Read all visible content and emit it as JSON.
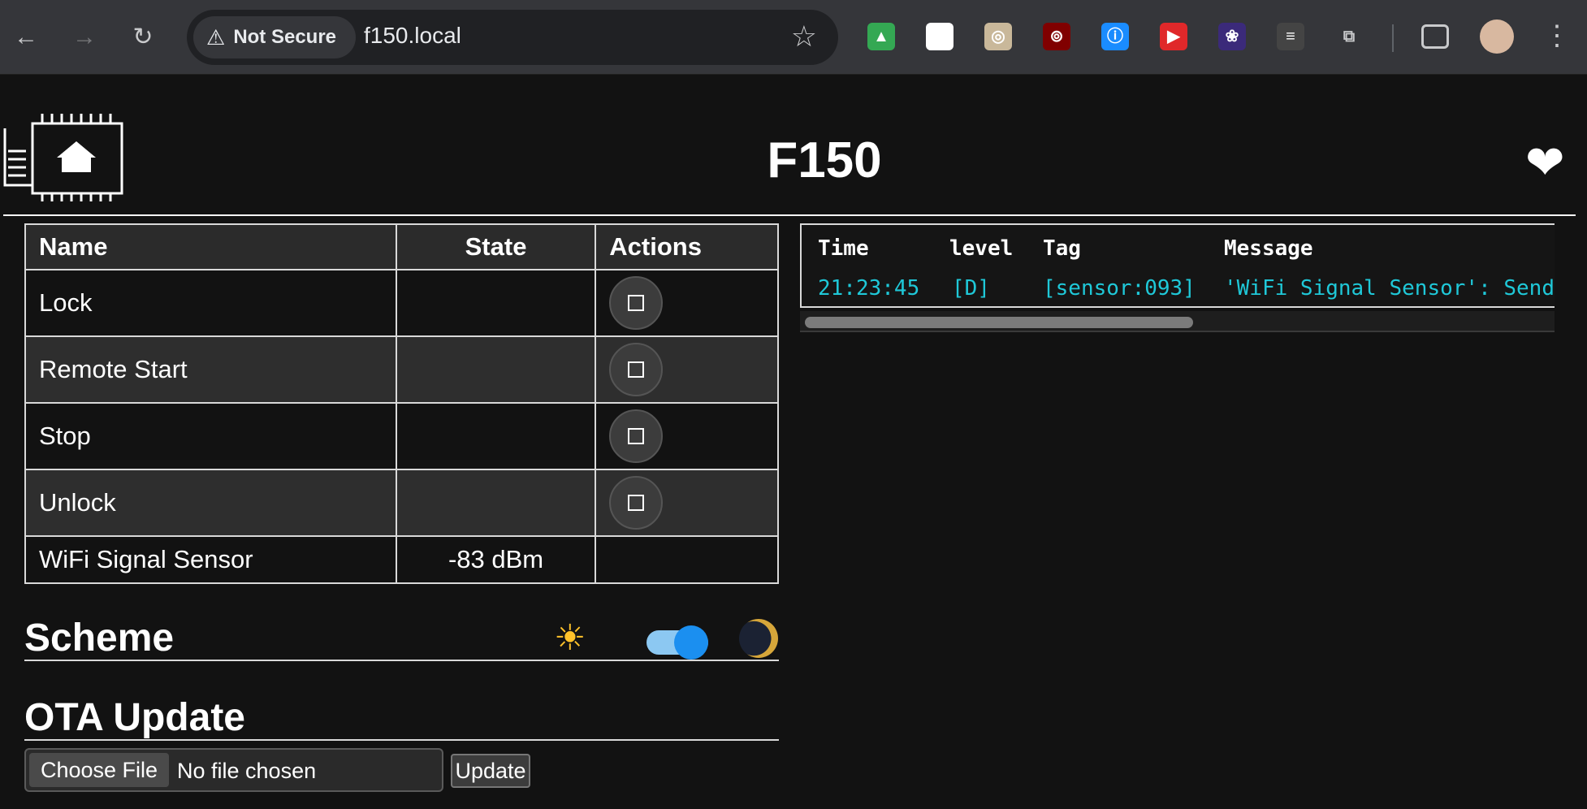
{
  "browser": {
    "security_label": "Not Secure",
    "url": "f150.local",
    "extensions": [
      {
        "icon": "google-drive-icon",
        "color": "#34a853"
      },
      {
        "icon": "picture-in-picture-icon",
        "color": "#ffffff"
      },
      {
        "icon": "owl-icon",
        "color": "#c9b89a"
      },
      {
        "icon": "ublock-origin-icon",
        "color": "#800000"
      },
      {
        "icon": "1password-icon",
        "color": "#1a8cff"
      },
      {
        "icon": "video-speed-icon",
        "color": "#e0282a"
      },
      {
        "icon": "color-wheel-icon",
        "color": "#3b2a7a"
      },
      {
        "icon": "reader-mode-icon",
        "color": "#444444"
      },
      {
        "icon": "extensions-puzzle-icon",
        "color": "#c9cacc"
      }
    ]
  },
  "header": {
    "title": "F150"
  },
  "entities": {
    "columns": {
      "name": "Name",
      "state": "State",
      "actions": "Actions"
    },
    "rows": [
      {
        "name": "Lock",
        "state": ""
      },
      {
        "name": "Remote Start",
        "state": ""
      },
      {
        "name": "Stop",
        "state": ""
      },
      {
        "name": "Unlock",
        "state": ""
      },
      {
        "name": "WiFi Signal Sensor",
        "state": "-83 dBm"
      }
    ]
  },
  "scheme": {
    "title": "Scheme",
    "dark_mode": true
  },
  "ota": {
    "title": "OTA Update",
    "choose_label": "Choose File",
    "file_status": "No file chosen",
    "update_label": "Update"
  },
  "log": {
    "columns": {
      "time": "Time",
      "level": "level",
      "tag": "Tag",
      "message": "Message"
    },
    "entries": [
      {
        "time": "21:23:45",
        "level": "[D]",
        "tag": "[sensor:093]",
        "message": "'WiFi Signal Sensor': Send"
      }
    ],
    "color": "#1fc8d8"
  }
}
